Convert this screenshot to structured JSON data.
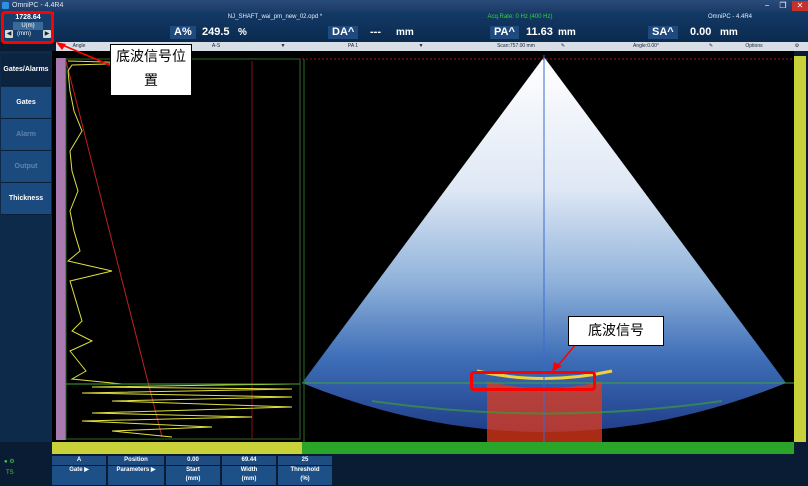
{
  "titlebar": {
    "title": "OmniPC - 4.4R4",
    "min": "−",
    "max": "❐",
    "close": "✕"
  },
  "position": {
    "value": "1728.64",
    "axis": "U(m)",
    "unit": "(mm)"
  },
  "header": {
    "file_name": "NJ_SHAFT_wai_pm_new_02.opd *",
    "acq_rate": "Acq.Rate: 0 Hz (400 Hz)",
    "app_name": "OmniPC - 4.4R4"
  },
  "readouts": [
    {
      "tag": "A%",
      "value": "249.5",
      "unit": "%"
    },
    {
      "tag": "DA^",
      "value": "---",
      "unit": "mm"
    },
    {
      "tag": "PA^",
      "value": "11.63",
      "unit": "mm"
    },
    {
      "tag": "SA^",
      "value": "0.00",
      "unit": "mm"
    }
  ],
  "tabs": {
    "angle": "Angle",
    "ascan": "A-S",
    "pa": "PA 1",
    "scan": "Scan:757.00 mm",
    "angle2": "Angle:0.00°",
    "options": "Options"
  },
  "sidebar": [
    "Gates/Alarms",
    "Gates",
    "Alarm",
    "Output",
    "Thickness"
  ],
  "bottom": {
    "gate_head": "A",
    "gate_label": "Gate",
    "param_head": "Position",
    "param_label": "Parameters",
    "start_head": "0.00",
    "start_label": "Start",
    "start_unit": "(mm)",
    "width_head": "69.44",
    "width_label": "Width",
    "width_unit": "(mm)",
    "threshold_head": "25",
    "threshold_label": "Threshold",
    "threshold_unit": "(%)",
    "status_ts": "TS"
  },
  "annotations": {
    "bottom_echo_position": "底波信号位置",
    "bottom_echo_signal": "底波信号"
  }
}
